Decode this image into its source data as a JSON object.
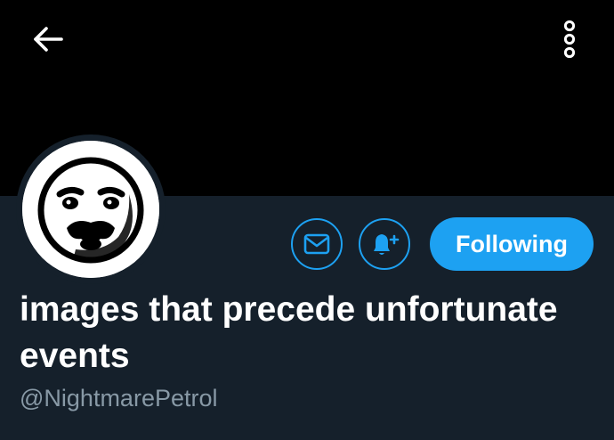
{
  "header": {
    "back_icon": "arrow-left-icon",
    "more_icon": "vertical-dots-icon"
  },
  "profile": {
    "display_name": "images that precede unfortunate events",
    "handle": "@NightmarePetrol",
    "avatar": "meme-face-avatar"
  },
  "actions": {
    "message_icon": "envelope-icon",
    "notify_icon": "bell-plus-icon",
    "following_label": "Following"
  },
  "colors": {
    "accent": "#1da1f2",
    "background": "#15202b",
    "banner": "#000000",
    "text_primary": "#ffffff",
    "text_secondary": "#8899a6"
  }
}
